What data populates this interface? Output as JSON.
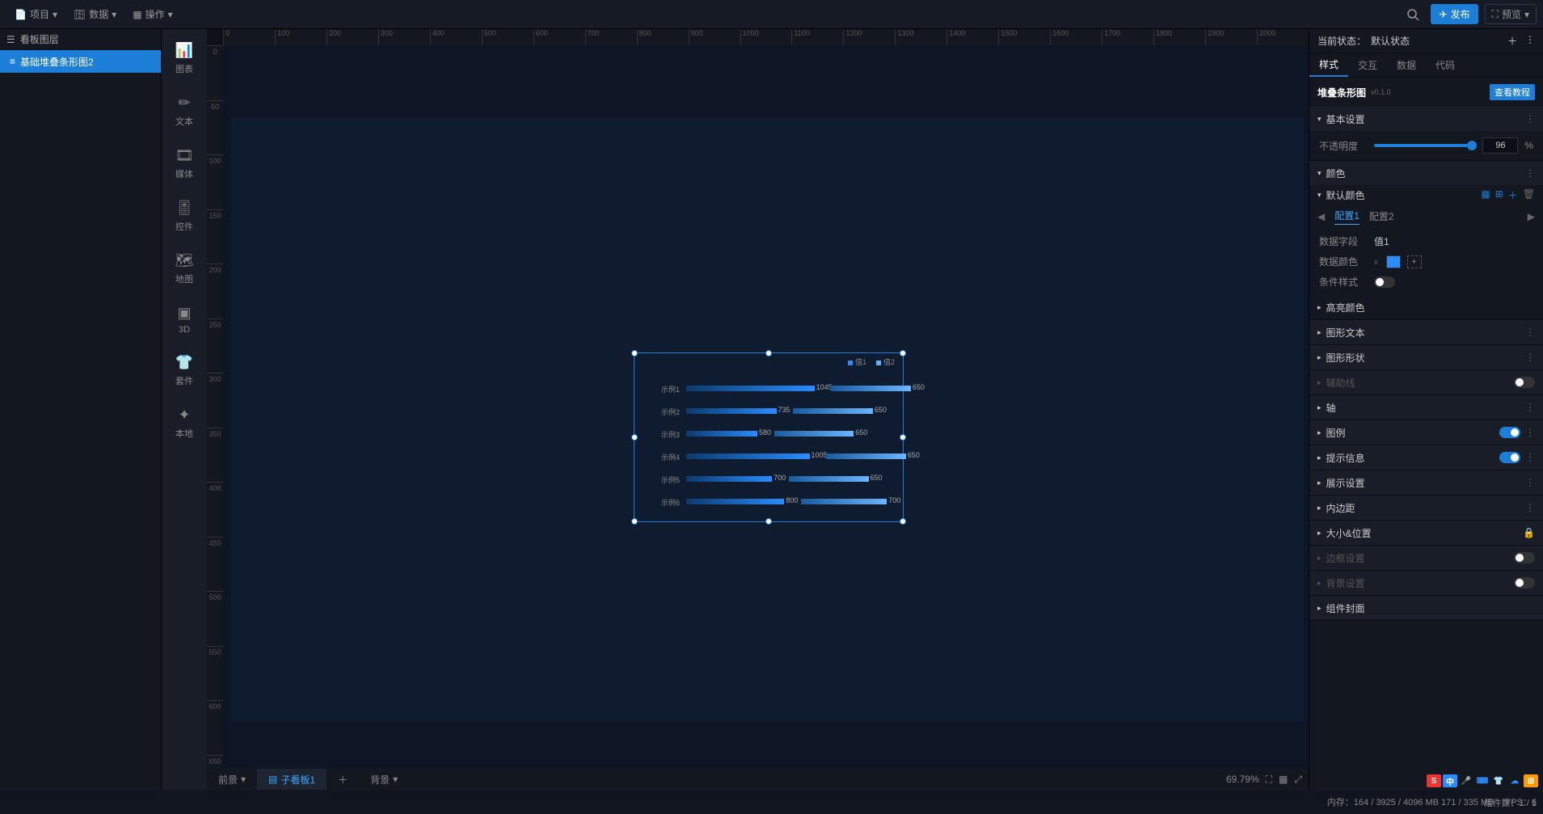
{
  "top": {
    "project": "项目",
    "data": "数据",
    "operate": "操作",
    "publish": "发布",
    "preview": "预览"
  },
  "left": {
    "panel_title": "看板图层",
    "layer1": "基础堆叠条形图2"
  },
  "compbar": {
    "chart": "图表",
    "text": "文本",
    "media": "媒体",
    "control": "控件",
    "map": "地图",
    "3d": "3D",
    "kit": "套件",
    "local": "本地"
  },
  "canvas": {
    "tab_fg": "前景",
    "tab_sub": "子看板1",
    "tab_bg": "背景",
    "zoom": "69.79%"
  },
  "chart_data": {
    "type": "bar",
    "orientation": "horizontal",
    "stacked": true,
    "categories": [
      "示例1",
      "示例2",
      "示例3",
      "示例4",
      "示例5",
      "示例6"
    ],
    "series": [
      {
        "name": "值1",
        "values": [
          1045,
          735,
          580,
          1005,
          700,
          800
        ]
      },
      {
        "name": "值2",
        "values": [
          650,
          650,
          650,
          650,
          650,
          700
        ]
      }
    ]
  },
  "prop": {
    "state_label": "当前状态：",
    "state_value": "默认状态",
    "tab_style": "样式",
    "tab_interact": "交互",
    "tab_data": "数据",
    "tab_code": "代码",
    "comp_name": "堆叠条形图",
    "comp_ver": "v0.1.0",
    "tutorial": "查看教程",
    "basic": "基本设置",
    "opacity_label": "不透明度",
    "opacity_value": "96",
    "pct": "%",
    "color": "颜色",
    "default_color": "默认颜色",
    "cfg1": "配置1",
    "cfg2": "配置2",
    "data_field": "数据字段",
    "data_field_val": "值1",
    "data_color": "数据颜色",
    "cond_style": "条件样式",
    "highlight": "高亮颜色",
    "graph_text": "图形文本",
    "graph_shape": "图形形状",
    "assist_line": "辅助线",
    "axis": "轴",
    "legend": "图例",
    "tooltip": "提示信息",
    "display": "展示设置",
    "padding": "内边距",
    "size_pos": "大小&位置",
    "border": "边框设置",
    "bg": "背景设置",
    "comp_cover": "组件封面"
  },
  "status": {
    "mem": "内存：164 / 3925 / 4096 MB  171 / 335 MB",
    "fps": "FPS：6",
    "compcount": "组件数：1 / 1"
  }
}
